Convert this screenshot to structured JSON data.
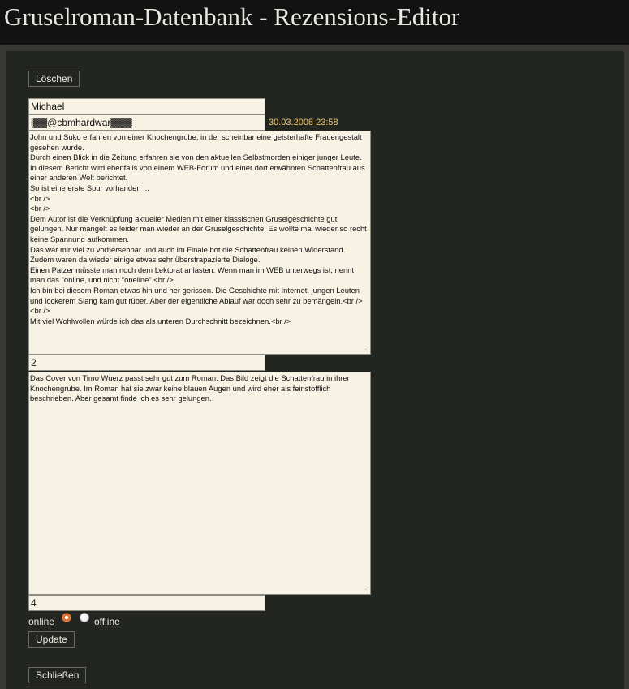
{
  "header": {
    "title": "Gruselroman-Datenbank - Rezensions-Editor"
  },
  "toolbar": {
    "delete_label": "Löschen",
    "update_label": "Update",
    "close_label": "Schließen"
  },
  "review": {
    "author_name": "Michael",
    "email": "i▓▓@cbmhardwar▓▓▓",
    "date": "30.03.2008 23:58",
    "text": "John und Suko erfahren von einer Knochengrube, in der scheinbar eine geisterhafte Frauengestalt gesehen wurde.\nDurch einen Blick in die Zeitung erfahren sie von den aktuellen Selbstmorden einiger junger Leute.\nIn diesem Bericht wird ebenfalls von einem WEB-Forum und einer dort erwähnten Schattenfrau aus einer anderen Welt berichtet.\nSo ist eine erste Spur vorhanden ...\n<br />\n<br />\nDem Autor ist die Verknüpfung aktueller Medien mit einer klassischen Gruselgeschichte gut gelungen. Nur mangelt es leider man wieder an der Gruselgeschichte. Es wollte mal wieder so recht keine Spannung aufkommen.\nDas war mir viel zu vorhersehbar und auch im Finale bot die Schattenfrau keinen Widerstand.\nZudem waren da wieder einige etwas sehr überstrapazierte Dialoge.\nEinen Patzer müsste man noch dem Lektorat anlasten. Wenn man im WEB unterwegs ist, nennt man das \"online, und nicht \"oneline\".<br />\nIch bin bei diesem Roman etwas hin und her gerissen. Die Geschichte mit Internet, jungen Leuten und lockerem Slang kam gut rüber. Aber der eigentliche Ablauf war doch sehr zu bemängeln.<br />\n<br />\nMit viel Wohlwollen würde ich das als unteren Durchschnitt bezeichnen.<br />",
    "rating": "2",
    "cover_text": "Das Cover von Timo Wuerz passt sehr gut zum Roman. Das Bild zeigt die Schattenfrau in ihrer Knochengrube. Im Roman hat sie zwar keine blauen Augen und wird eher als feinstofflich beschrieben. Aber gesamt finde ich es sehr gelungen.",
    "cover_rating": "4"
  },
  "status": {
    "online_label": "online",
    "offline_label": "offline",
    "selected": "online"
  },
  "colors": {
    "background": "#111211",
    "panel": "#232521",
    "field": "#f7f2e3",
    "date_accent": "#f0c96a",
    "radio_accent": "#d96a22"
  }
}
